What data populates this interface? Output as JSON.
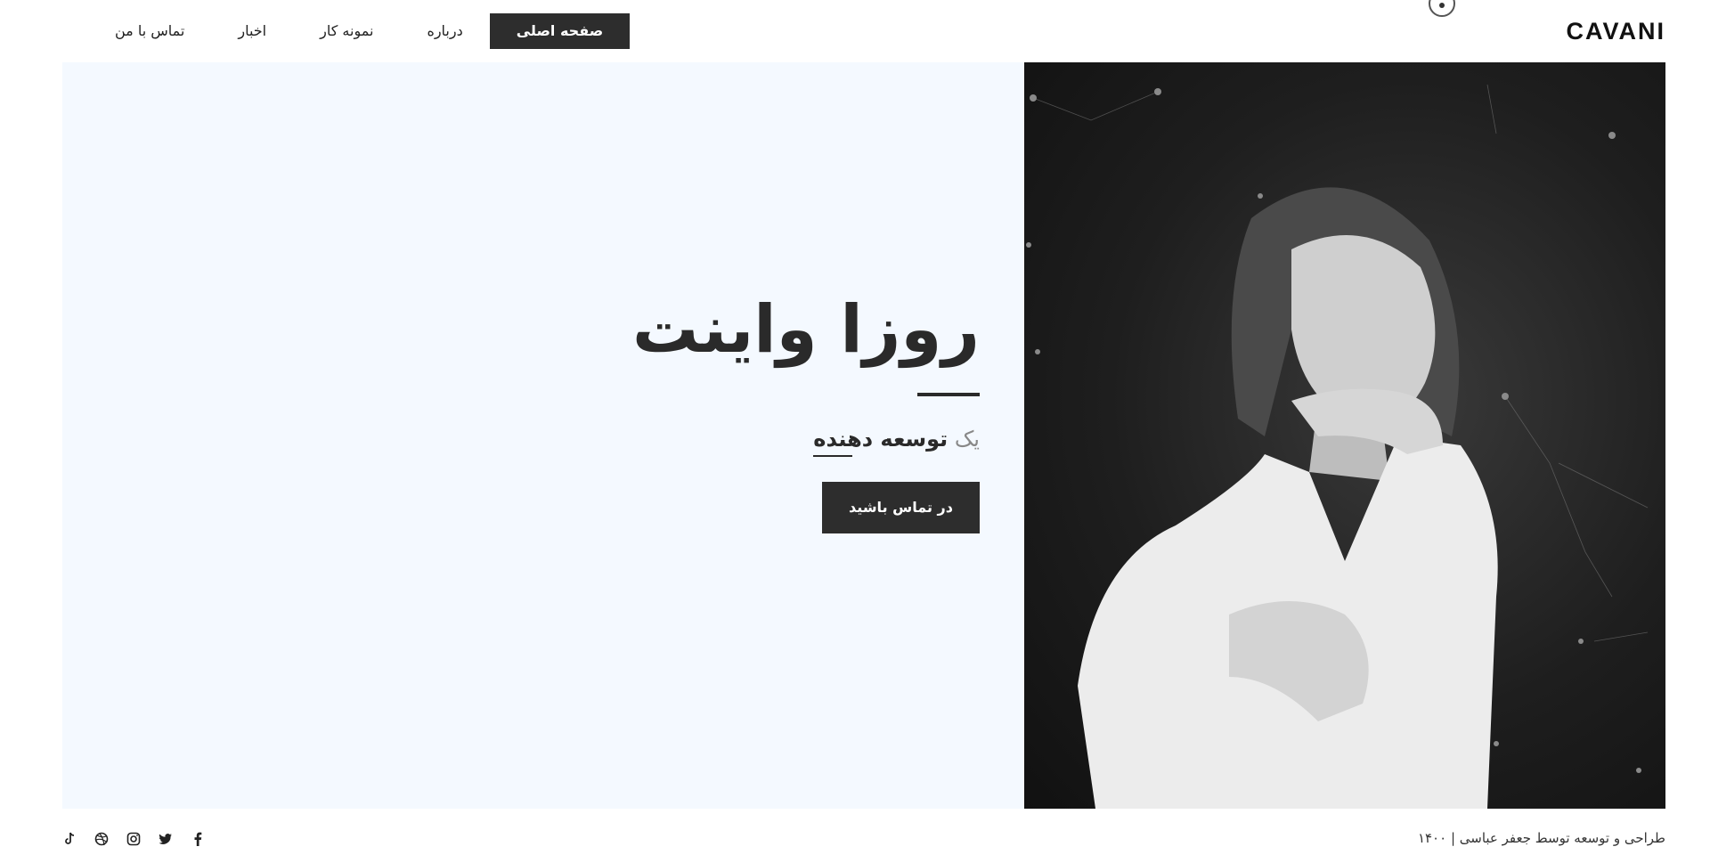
{
  "header": {
    "logo": "CAVANI",
    "nav": [
      {
        "label": "صفحه اصلی",
        "active": true
      },
      {
        "label": "درباره",
        "active": false
      },
      {
        "label": "نمونه کار",
        "active": false
      },
      {
        "label": "اخبار",
        "active": false
      },
      {
        "label": "تماس با من",
        "active": false
      }
    ]
  },
  "hero": {
    "name": "روزا واینت",
    "subtitle_prefix": "یک",
    "subtitle_role": "توسعه دهنده",
    "cta_label": "در تماس باشید",
    "photo_icon": "portrait-photo"
  },
  "footer": {
    "credit": "طراحی و توسعه توسط جعفر عباسی | ۱۴۰۰",
    "socials": [
      "facebook-icon",
      "twitter-icon",
      "instagram-icon",
      "dribbble-icon",
      "tiktok-icon"
    ]
  },
  "colors": {
    "accent": "#2d2d2d",
    "hero_bg": "#f4f9ff"
  }
}
